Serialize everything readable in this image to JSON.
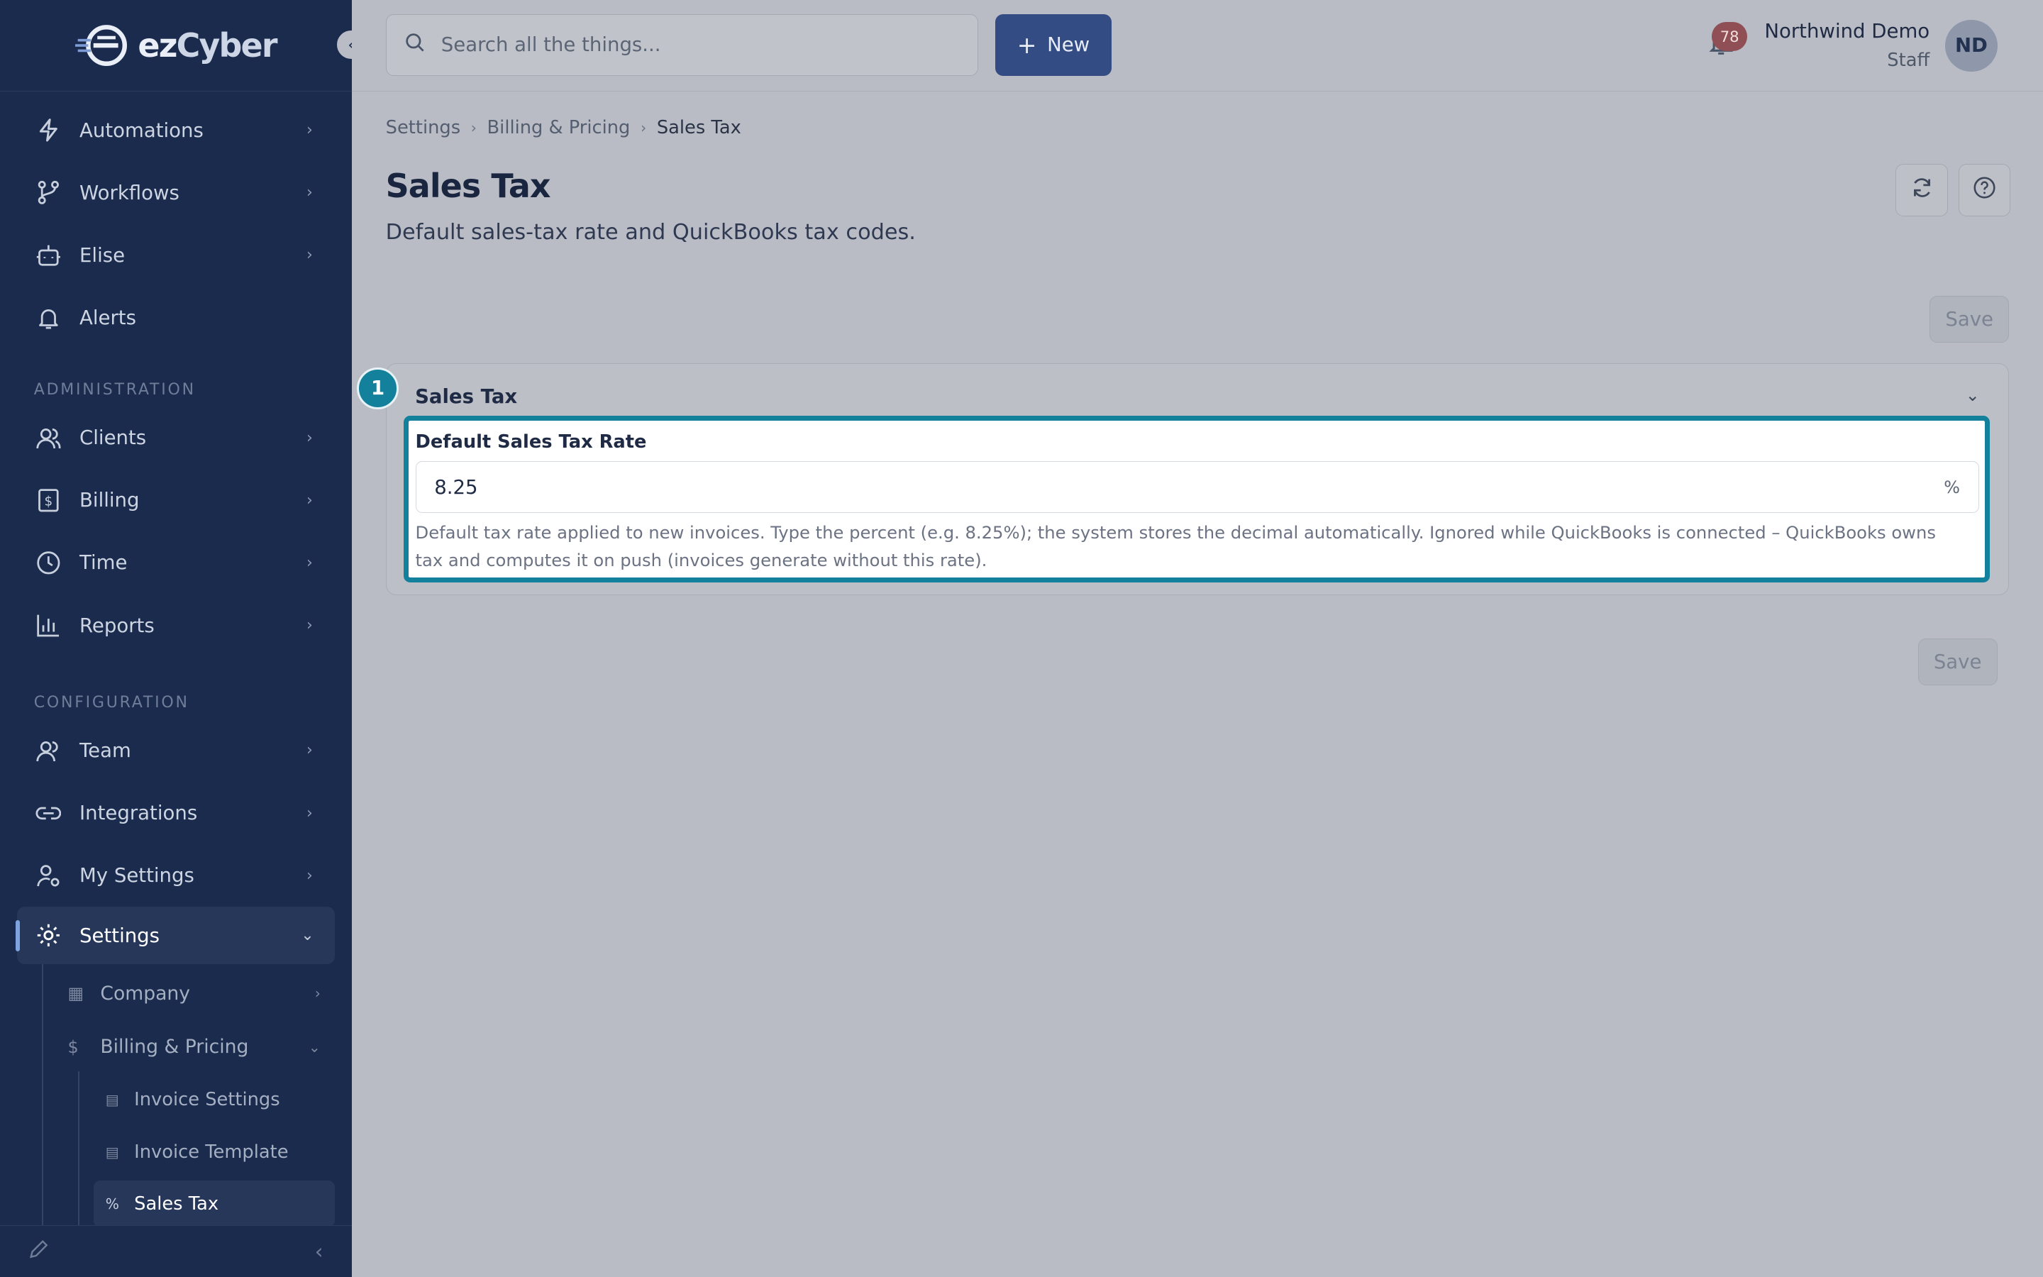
{
  "brand": {
    "name_part1": "ez",
    "name_part2": "Cyber"
  },
  "sidebar": {
    "items_top": [
      {
        "label": "Automations",
        "icon": "lightning-icon"
      },
      {
        "label": "Workflows",
        "icon": "git-branch-icon"
      },
      {
        "label": "Elise",
        "icon": "robot-icon"
      },
      {
        "label": "Alerts",
        "icon": "bell-icon"
      }
    ],
    "section_admin": "ADMINISTRATION",
    "items_admin": [
      {
        "label": "Clients",
        "icon": "users-icon"
      },
      {
        "label": "Billing",
        "icon": "dollar-receipt-icon"
      },
      {
        "label": "Time",
        "icon": "clock-icon"
      },
      {
        "label": "Reports",
        "icon": "bar-chart-icon"
      }
    ],
    "section_config": "CONFIGURATION",
    "items_config": [
      {
        "label": "Team",
        "icon": "team-icon"
      },
      {
        "label": "Integrations",
        "icon": "link-icon"
      },
      {
        "label": "My Settings",
        "icon": "user-gear-icon"
      },
      {
        "label": "Settings",
        "icon": "gear-icon"
      }
    ],
    "sub_company": "Company",
    "sub_billing": "Billing & Pricing",
    "sub2_invoice_settings": "Invoice Settings",
    "sub2_invoice_template": "Invoice Template",
    "sub2_sales_tax": "Sales Tax"
  },
  "topbar": {
    "search_placeholder": "Search all the things...",
    "new_label": "New",
    "notification_count": "78",
    "user_name": "Northwind Demo",
    "user_role": "Staff",
    "avatar_initials": "ND"
  },
  "breadcrumb": [
    "Settings",
    "Billing & Pricing",
    "Sales Tax"
  ],
  "page": {
    "title": "Sales Tax",
    "subtitle": "Default sales-tax rate and QuickBooks tax codes.",
    "save_label": "Save"
  },
  "card": {
    "step": "1",
    "title": "Sales Tax",
    "field_label": "Default Sales Tax Rate",
    "field_value": "8.25",
    "field_unit": "%",
    "field_help": "Default tax rate applied to new invoices. Type the percent (e.g. 8.25%); the system stores the decimal automatically. Ignored while QuickBooks is connected – QuickBooks owns tax and computes it on push (invoices generate without this rate)."
  },
  "colors": {
    "sidebar_bg": "#1b2b4d",
    "accent": "#344c84",
    "highlight": "#13809c",
    "badge": "#8f4f55"
  }
}
